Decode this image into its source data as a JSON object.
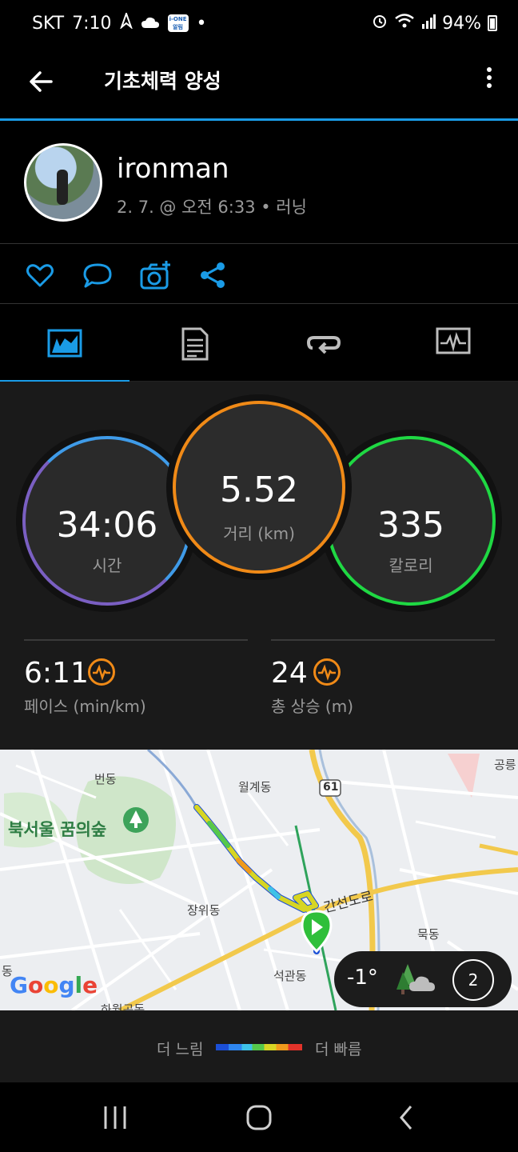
{
  "status_bar": {
    "carrier": "SKT",
    "time": "7:10",
    "badge": "i-ONE 알림",
    "battery": "94%"
  },
  "app_bar": {
    "title": "기초체력 양성"
  },
  "profile": {
    "username": "ironman",
    "meta": "2. 7. @ 오전 6:33 • 러닝"
  },
  "actions": [
    "heart-icon",
    "comment-icon",
    "camera-icon",
    "share-icon"
  ],
  "tabs": [
    "stats-tab",
    "details-tab",
    "laps-tab",
    "graphs-tab"
  ],
  "stats": {
    "time": {
      "value": "34:06",
      "label": "시간",
      "color": "#3f9be8"
    },
    "distance": {
      "value": "5.52",
      "label": "거리 (km)",
      "color": "#f08a17"
    },
    "calories": {
      "value": "335",
      "label": "칼로리",
      "color": "#1fd843"
    },
    "pace": {
      "value": "6:11",
      "label": "페이스 (min/km)"
    },
    "ascent": {
      "value": "24",
      "label": "총 상승 (m)"
    }
  },
  "map": {
    "places": [
      "번동",
      "월계동",
      "북서울 꿈의숲",
      "장위동",
      "석관동",
      "묵동",
      "공릉",
      "하월곡동",
      "동"
    ],
    "road_label": "간선도로",
    "route_badge": "61",
    "weather_temp": "-1°",
    "wind_speed": "2",
    "attribution": "Google"
  },
  "legend": {
    "slow": "더 느림",
    "fast": "더 빠름"
  }
}
